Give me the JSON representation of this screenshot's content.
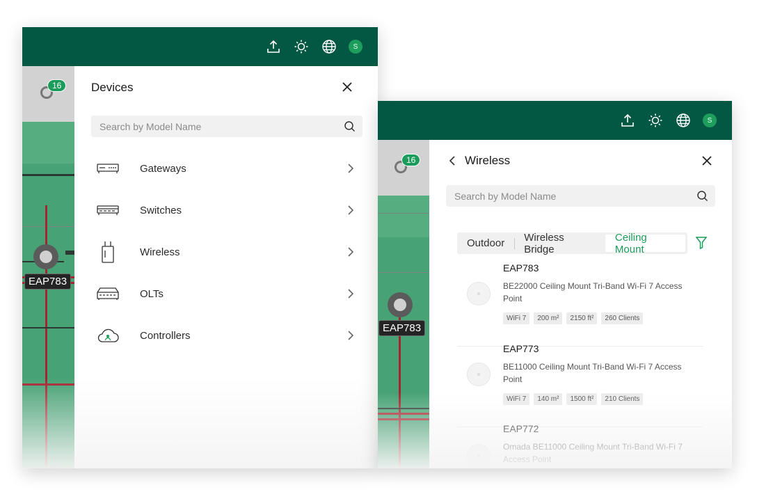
{
  "topbar": {
    "icons": [
      "upload-icon",
      "brightness-icon",
      "globe-icon"
    ],
    "avatar_initial": "S",
    "color": "#035843"
  },
  "map": {
    "counter": "16",
    "ap_labels": [
      "EAP783",
      "EAP783"
    ]
  },
  "devices_panel": {
    "title": "Devices",
    "search_placeholder": "Search by Model Name",
    "categories": [
      {
        "label": "Gateways",
        "icon": "gateway-icon"
      },
      {
        "label": "Switches",
        "icon": "switch-icon"
      },
      {
        "label": "Wireless",
        "icon": "wireless-icon"
      },
      {
        "label": "OLTs",
        "icon": "olt-icon"
      },
      {
        "label": "Controllers",
        "icon": "cloud-controller-icon"
      }
    ]
  },
  "wireless_panel": {
    "title": "Wireless",
    "search_placeholder": "Search by Model Name",
    "tabs": [
      "Outdoor",
      "Wireless Bridge",
      "Ceiling Mount"
    ],
    "active_tab": "Ceiling Mount",
    "accent_color": "#1b9c5b",
    "products": [
      {
        "name": "EAP783",
        "desc": "BE22000 Ceiling Mount Tri-Band Wi-Fi 7 Access Point",
        "tags": [
          "WiFi 7",
          "200 m²",
          "2150 ft²",
          "260 Clients"
        ]
      },
      {
        "name": "EAP773",
        "desc": "BE11000 Ceiling Mount Tri-Band Wi-Fi 7 Access Point",
        "tags": [
          "WiFi 7",
          "140 m²",
          "1500 ft²",
          "210 Clients"
        ]
      },
      {
        "name": "EAP772",
        "desc": "Omada BE11000 Ceiling Mount Tri-Band Wi-Fi 7 Access Point",
        "tags": []
      }
    ]
  }
}
